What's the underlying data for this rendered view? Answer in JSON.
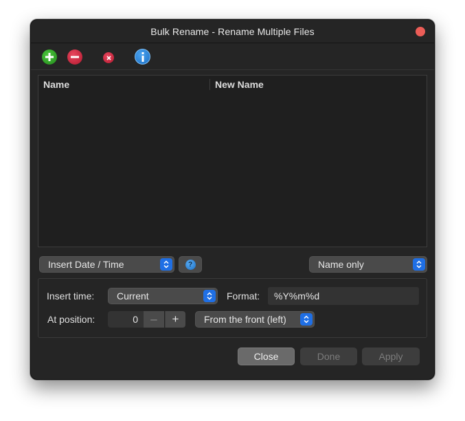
{
  "window": {
    "title": "Bulk Rename - Rename Multiple Files"
  },
  "toolbar": {
    "add_icon": "plus-circle-icon",
    "remove_icon": "minus-circle-icon",
    "clear_icon": "x-circle-icon",
    "info_icon": "info-circle-icon"
  },
  "list": {
    "columns": [
      "Name",
      "New Name"
    ],
    "rows": []
  },
  "controls": {
    "mode_select": "Insert Date / Time",
    "help_glyph": "?",
    "scope_select": "Name only"
  },
  "options": {
    "insert_time_label": "Insert time:",
    "insert_time_value": "Current",
    "format_label": "Format:",
    "format_value": "%Y%m%d",
    "position_label": "At position:",
    "position_value": "0",
    "minus_glyph": "–",
    "plus_glyph": "+",
    "position_from": "From the front (left)"
  },
  "buttons": {
    "close": "Close",
    "done": "Done",
    "apply": "Apply"
  },
  "colors": {
    "accent": "#1f6fe5",
    "close_dot": "#ec5d57",
    "add": "#2fa32a",
    "remove": "#c8223a",
    "info": "#2a86dc"
  }
}
